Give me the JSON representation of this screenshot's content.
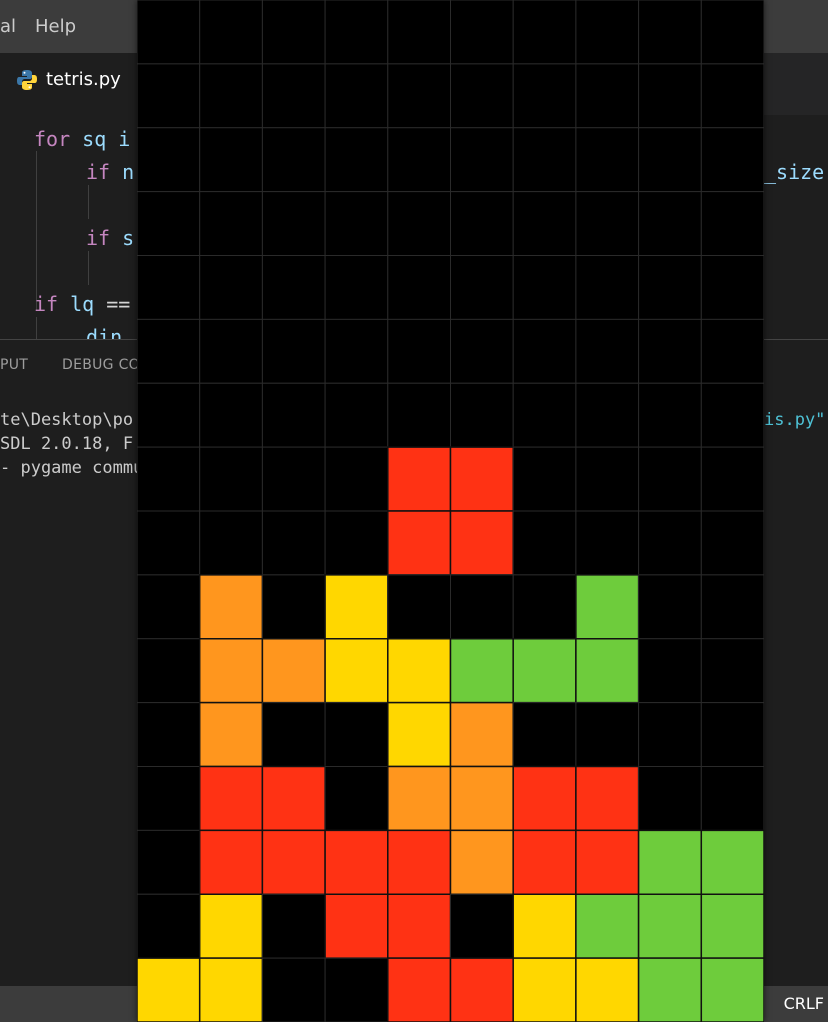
{
  "menubar": {
    "items": [
      "al",
      "Help"
    ]
  },
  "editor_tab": {
    "label": "tetris.py",
    "icon": "python-icon"
  },
  "code": {
    "lines": [
      [
        {
          "t": "for",
          "c": "kw"
        },
        {
          "t": " sq i",
          "c": "id"
        }
      ],
      [
        {
          "t": "if",
          "c": "kw"
        },
        {
          "t": " n",
          "c": "id"
        }
      ],
      [],
      [
        {
          "t": "if",
          "c": "kw"
        },
        {
          "t": " s",
          "c": "id"
        }
      ],
      [],
      [
        {
          "t": "if",
          "c": "kw"
        },
        {
          "t": " lq ",
          "c": "id"
        },
        {
          "t": "==",
          "c": "op"
        }
      ],
      [
        {
          "t": "din",
          "c": "id"
        }
      ]
    ],
    "right_fragment": "_size"
  },
  "panel": {
    "tabs": [
      "PUT",
      "DEBUG CO"
    ],
    "terminal_lines": [
      "te\\Desktop\\po",
      "SDL 2.0.18, F",
      "- pygame commu"
    ],
    "terminal_right": "is.py\""
  },
  "statusbar": {
    "eol": "CRLF"
  },
  "game": {
    "cols": 10,
    "rows": 16,
    "empty_color": "#000000",
    "grid_color": "#2a2a2a",
    "palette": {
      "R": "#ff3214",
      "O": "#ff961e",
      "Y": "#ffd700",
      "G": "#6ecc3c"
    },
    "board": [
      "..........",
      "..........",
      "..........",
      "..........",
      "..........",
      "..........",
      "..........",
      "....RR....",
      "....RR....",
      ".O.Y...G..",
      ".OOYYGGG..",
      ".O..YO....",
      ".RR.OORR..",
      ".RRRRORRGG",
      ".Y.RR.YGGG",
      "YY..RRYYGG"
    ]
  }
}
